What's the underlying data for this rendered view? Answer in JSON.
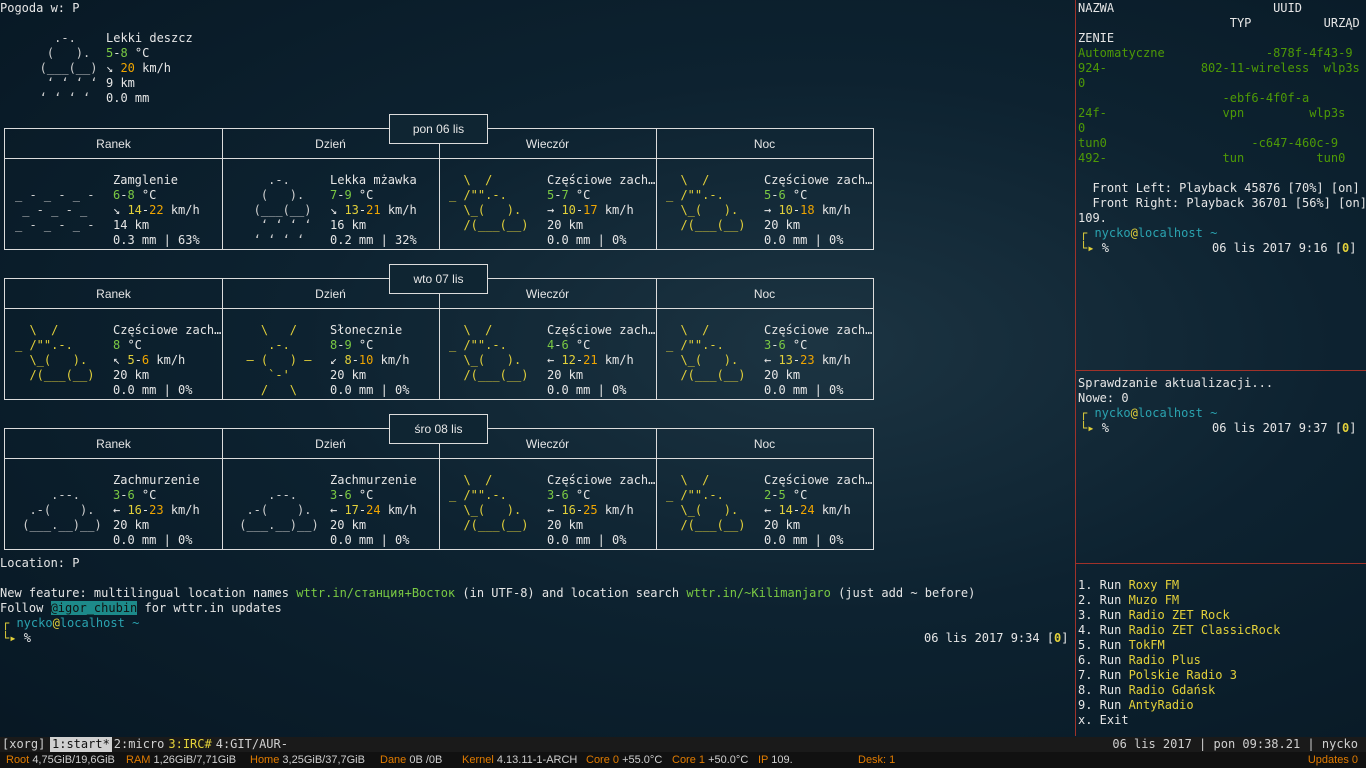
{
  "weather": {
    "title": "Pogoda w: P",
    "current": {
      "art": [
        "     .-.   ",
        "    (   ).  ",
        "   (___(__) ",
        "    ʻ ʻ ʻ ʻ  ",
        "   ʻ ʻ ʻ ʻ   "
      ],
      "condition": "Lekki deszcz",
      "temp_low": "5",
      "temp_sep": "-",
      "temp_high": "8",
      "temp_unit": " °C",
      "wind_arrow": "↘ ",
      "wind_val": "20",
      "wind_unit": " km/h",
      "visibility": "9 km",
      "precip": "0.0 mm"
    },
    "column_labels": [
      "Ranek",
      "Dzień",
      "Wieczór",
      "Noc"
    ],
    "days": [
      {
        "date": "pon 06 lis",
        "cells": [
          {
            "art": [
              " ",
              "_ - _ - _ - ",
              " _ - _ - _  ",
              "_ - _ - _ - "
            ],
            "cond": "Zamglenie",
            "t1": "6",
            "t2": "8",
            "unit": " °C",
            "arrow": "↘ ",
            "w1": "14",
            "w2": "22",
            "wunit": " km/h",
            "vis": "14 km",
            "precip": "0.3 mm | 63%"
          },
          {
            "art": [
              "     .-.   ",
              "    (   ).  ",
              "   (___(__) ",
              "    ʻ ʻ ʻ ʻ  ",
              "   ʻ ʻ ʻ ʻ   "
            ],
            "cond": "Lekka mżawka",
            "t1": "7",
            "t2": "9",
            "unit": " °C",
            "arrow": "↘ ",
            "w1": "13",
            "w2": "21",
            "wunit": " km/h",
            "vis": "16 km",
            "precip": "0.2 mm | 32%"
          },
          {
            "art": [
              "  \\  /      ",
              "_ /\"\".-.    ",
              "  \\_(   ).  ",
              "  /(___(__) "
            ],
            "cond": "Częściowe zach…",
            "t1": "5",
            "t2": "7",
            "unit": " °C",
            "arrow": "→ ",
            "w1": "10",
            "w2": "17",
            "wunit": " km/h",
            "vis": "20 km",
            "precip": "0.0 mm | 0%"
          },
          {
            "art": [
              "  \\  /      ",
              "_ /\"\".-.    ",
              "  \\_(   ).  ",
              "  /(___(__) "
            ],
            "cond": "Częściowe zach…",
            "t1": "5",
            "t2": "6",
            "unit": " °C",
            "arrow": "→ ",
            "w1": "10",
            "w2": "18",
            "wunit": " km/h",
            "vis": "20 km",
            "precip": "0.0 mm | 0%"
          }
        ]
      },
      {
        "date": "wto 07 lis",
        "cells": [
          {
            "art": [
              "  \\  /      ",
              "_ /\"\".-.    ",
              "  \\_(   ).  ",
              "  /(___(__) "
            ],
            "cond": "Częściowe zach…",
            "t1": "8",
            "t2": "",
            "unit": " °C",
            "arrow": "↖ ",
            "w1": "5",
            "w2": "6",
            "wunit": " km/h",
            "vis": "20 km",
            "precip": "0.0 mm | 0%"
          },
          {
            "art": [
              "    \\   /    ",
              "     .-.     ",
              "  ― (   ) ―  ",
              "     `-'     ",
              "    /   \\    "
            ],
            "cond": "Słonecznie",
            "t1": "8",
            "t2": "9",
            "unit": " °C",
            "arrow": "↙ ",
            "w1": "8",
            "w2": "10",
            "wunit": " km/h",
            "vis": "20 km",
            "precip": "0.0 mm | 0%"
          },
          {
            "art": [
              "  \\  /      ",
              "_ /\"\".-.    ",
              "  \\_(   ).  ",
              "  /(___(__) "
            ],
            "cond": "Częściowe zach…",
            "t1": "4",
            "t2": "6",
            "unit": " °C",
            "arrow": "← ",
            "w1": "12",
            "w2": "21",
            "wunit": " km/h",
            "vis": "20 km",
            "precip": "0.0 mm | 0%"
          },
          {
            "art": [
              "  \\  /      ",
              "_ /\"\".-.    ",
              "  \\_(   ).  ",
              "  /(___(__) "
            ],
            "cond": "Częściowe zach…",
            "t1": "3",
            "t2": "6",
            "unit": " °C",
            "arrow": "← ",
            "w1": "13",
            "w2": "23",
            "wunit": " km/h",
            "vis": "20 km",
            "precip": "0.0 mm | 0%"
          }
        ]
      },
      {
        "date": "śro 08 lis",
        "cells": [
          {
            "art": [
              " ",
              "     .--.   ",
              "  .-(    ).  ",
              " (___.__)__) "
            ],
            "cond": "Zachmurzenie",
            "t1": "3",
            "t2": "6",
            "unit": " °C",
            "arrow": "← ",
            "w1": "16",
            "w2": "23",
            "wunit": " km/h",
            "vis": "20 km",
            "precip": "0.0 mm | 0%"
          },
          {
            "art": [
              " ",
              "     .--.   ",
              "  .-(    ).  ",
              " (___.__)__) "
            ],
            "cond": "Zachmurzenie",
            "t1": "3",
            "t2": "6",
            "unit": " °C",
            "arrow": "← ",
            "w1": "17",
            "w2": "24",
            "wunit": " km/h",
            "vis": "20 km",
            "precip": "0.0 mm | 0%"
          },
          {
            "art": [
              "  \\  /      ",
              "_ /\"\".-.    ",
              "  \\_(   ).  ",
              "  /(___(__) "
            ],
            "cond": "Częściowe zach…",
            "t1": "3",
            "t2": "6",
            "unit": " °C",
            "arrow": "← ",
            "w1": "16",
            "w2": "25",
            "wunit": " km/h",
            "vis": "20 km",
            "precip": "0.0 mm | 0%"
          },
          {
            "art": [
              "  \\  /      ",
              "_ /\"\".-.    ",
              "  \\_(   ).  ",
              "  /(___(__) "
            ],
            "cond": "Częściowe zach…",
            "t1": "2",
            "t2": "5",
            "unit": " °C",
            "arrow": "← ",
            "w1": "14",
            "w2": "24",
            "wunit": " km/h",
            "vis": "20 km",
            "precip": "0.0 mm | 0%"
          }
        ]
      }
    ],
    "location": "Location: P",
    "feature_pre": "New feature: multilingual location names ",
    "feature_link1": "wttr.in/станция+Восток",
    "feature_mid": " (in UTF-8) and location search ",
    "feature_link2": "wttr.in/~Kilimanjaro",
    "feature_post": " (just add ~ before)",
    "follow_pre": "Follow ",
    "follow_handle": "@igor_chubin",
    "follow_post": " for wttr.in updates"
  },
  "prompt_left": {
    "user": "nycko",
    "at": "@",
    "host": "localhost",
    "path": " ~",
    "symbol": "%",
    "time": "06 lis 2017 9:34",
    "code": "0"
  },
  "nmcli": {
    "header1": "NAZWA                      UUID",
    "header2": "                     TYP          URZĄD",
    "header3": "ZENIE",
    "rows": [
      [
        "Automatyczne",
        "              -878f-4f43-9"
      ],
      [
        "924-",
        "             802-11-wireless  wlp3s"
      ],
      [
        "0",
        ""
      ],
      [
        "",
        "                    -ebf6-4f0f-a"
      ],
      [
        "24f-",
        "                vpn         wlp3s"
      ],
      [
        "0",
        ""
      ],
      [
        "tun0",
        "                    -c647-460c-9"
      ],
      [
        "492-",
        "                tun          tun0"
      ]
    ],
    "playback1": "  Front Left: Playback 45876 [70%] [on]",
    "playback2": "  Front Right: Playback 36701 [56%] [on]",
    "playback3": "109.",
    "prompt_time": "06 lis 2017 9:16",
    "prompt_code": "0"
  },
  "updates": {
    "line1": "Sprawdzanie aktualizacji...",
    "line2": "Nowe: 0",
    "prompt_time": "06 lis 2017 9:37",
    "prompt_code": "0"
  },
  "radio_menu": {
    "items": [
      {
        "num": "1.",
        "run": " Run ",
        "name": "Roxy FM"
      },
      {
        "num": "2.",
        "run": " Run ",
        "name": "Muzo FM"
      },
      {
        "num": "3.",
        "run": " Run ",
        "name": "Radio ZET Rock"
      },
      {
        "num": "4.",
        "run": " Run ",
        "name": "Radio ZET ClassicRock"
      },
      {
        "num": "5.",
        "run": " Run ",
        "name": "TokFM"
      },
      {
        "num": "6.",
        "run": " Run ",
        "name": "Radio Plus"
      },
      {
        "num": "7.",
        "run": " Run ",
        "name": "Polskie Radio 3"
      },
      {
        "num": "8.",
        "run": " Run ",
        "name": "Radio Gdańsk"
      },
      {
        "num": "9.",
        "run": " Run ",
        "name": "AntyRadio"
      }
    ],
    "exit": "x. Exit"
  },
  "tmux": {
    "session": "[xorg]",
    "windows": [
      {
        "label": "1:start*",
        "active": true
      },
      {
        "label": "2:micro",
        "active": false
      },
      {
        "label": "3:IRC#",
        "active": false
      },
      {
        "label": "4:GIT/AUR-",
        "active": false
      }
    ],
    "right": "06 lis 2017 | pon 09:38.21 | nycko"
  },
  "status": {
    "root_lbl": "Root",
    "root_val": "4,75GiB/19,6GiB",
    "ram_lbl": "RAM",
    "ram_val": "1,26GiB/7,71GiB",
    "home_lbl": "Home",
    "home_val": "3,25GiB/37,7GiB",
    "dane_lbl": "Dane",
    "dane_val": "0B /0B",
    "kernel_lbl": "Kernel",
    "kernel_val": "4.13.11-1-ARCH",
    "core0_lbl": "Core 0",
    "core0_val": "+55.0°C",
    "core1_lbl": "Core 1",
    "core1_val": "+50.0°C",
    "ip_lbl": "IP",
    "ip_val": "109.",
    "desk": "Desk: 1",
    "updates": "Updates 0"
  },
  "colors": {
    "accent_green": "#7ac943",
    "accent_yellow": "#e3d13a",
    "accent_orange": "#f0a500",
    "accent_cyan": "#2aa3b0",
    "separator_red": "#a0322a"
  }
}
